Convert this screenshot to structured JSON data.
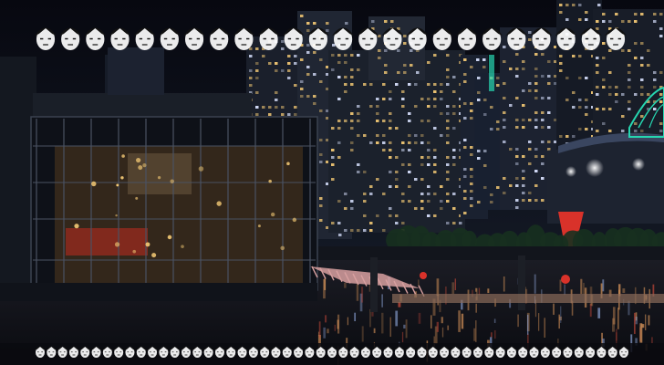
{
  "scene": {
    "description_label": "",
    "colors": {
      "sky_top": "#070810",
      "sky_bottom": "#141a26",
      "water_top": "#1b1c24",
      "water_bottom": "#0a0b10",
      "window_warm": "#f2c874",
      "window_cool": "#d9e2ff",
      "accent_red": "#d9322a",
      "accent_green": "#26d6b0",
      "dock": "#d8a0a0"
    },
    "top_glyph_row": {
      "glyph": "face-icon",
      "count": 24
    },
    "bottom_glyph_row": {
      "glyph": "face-icon",
      "count": 53
    }
  }
}
